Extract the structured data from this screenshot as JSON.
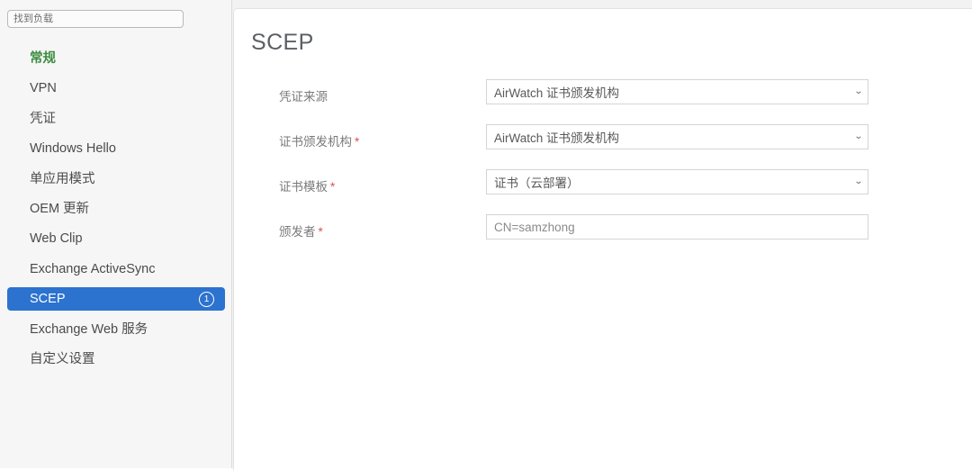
{
  "sidebar": {
    "search": {
      "placeholder": "找到负载",
      "value": ""
    },
    "items": [
      {
        "label": "常规",
        "style": "general",
        "selected": false,
        "badge": ""
      },
      {
        "label": "VPN",
        "style": "normal",
        "selected": false,
        "badge": ""
      },
      {
        "label": "凭证",
        "style": "normal",
        "selected": false,
        "badge": ""
      },
      {
        "label": "Windows Hello",
        "style": "normal",
        "selected": false,
        "badge": ""
      },
      {
        "label": "单应用模式",
        "style": "normal",
        "selected": false,
        "badge": ""
      },
      {
        "label": "OEM 更新",
        "style": "normal",
        "selected": false,
        "badge": ""
      },
      {
        "label": "Web Clip",
        "style": "normal",
        "selected": false,
        "badge": ""
      },
      {
        "label": "Exchange ActiveSync",
        "style": "normal",
        "selected": false,
        "badge": ""
      },
      {
        "label": "SCEP",
        "style": "normal",
        "selected": true,
        "badge": "1"
      },
      {
        "label": "Exchange Web 服务",
        "style": "normal",
        "selected": false,
        "badge": ""
      },
      {
        "label": "自定义设置",
        "style": "normal",
        "selected": false,
        "badge": ""
      }
    ]
  },
  "main": {
    "title": "SCEP",
    "fields": [
      {
        "label": "凭证来源",
        "required": false,
        "type": "select",
        "value": "AirWatch 证书颁发机构",
        "icon": "chevron-down-icon",
        "name": "credential-source"
      },
      {
        "label": "证书颁发机构",
        "required": true,
        "type": "select",
        "value": "AirWatch 证书颁发机构",
        "icon": "chevron-down-icon",
        "name": "certificate-authority"
      },
      {
        "label": "证书模板",
        "required": true,
        "type": "select",
        "value": "证书（云部署）",
        "icon": "chevron-down-icon",
        "name": "certificate-template"
      },
      {
        "label": "颁发者",
        "required": true,
        "type": "text",
        "value": "CN=samzhong",
        "icon": "",
        "name": "issuer"
      }
    ]
  },
  "colors": {
    "accent_blue": "#2c72cf",
    "general_green": "#3b8c3f",
    "required_red": "#d9534f",
    "sidebar_bg": "#f6f6f6"
  },
  "glyphs": {
    "chevron_down": "⌄",
    "asterisk": "*"
  }
}
